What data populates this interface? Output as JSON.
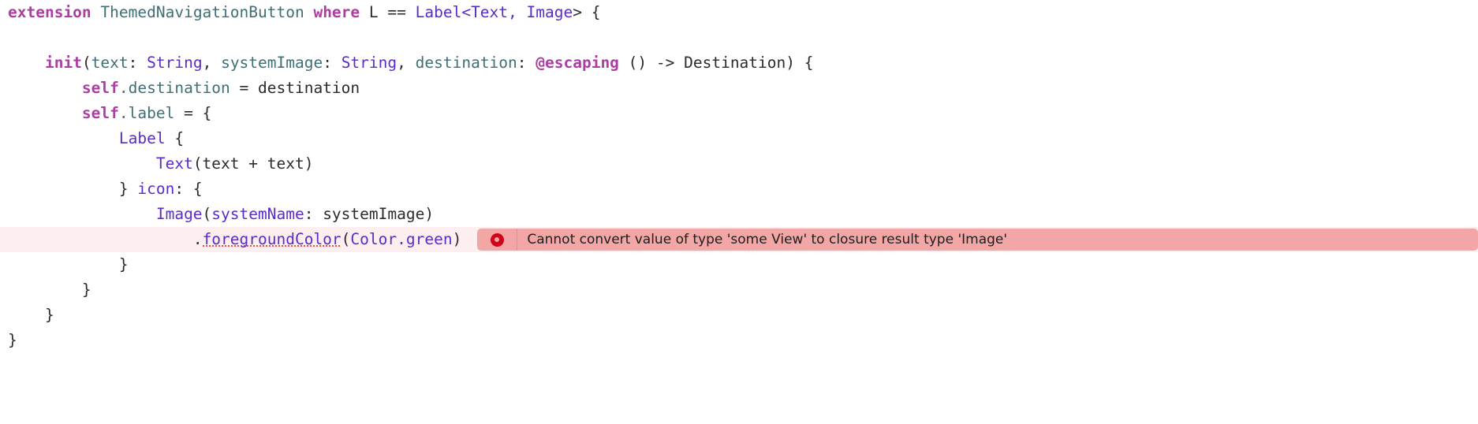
{
  "editor": {
    "language": "Swift",
    "background_color": "#ffffff",
    "font_size_px": 19,
    "line_height_px": 32,
    "colors": {
      "keyword": "#ad3da4",
      "type": "#3f6e74",
      "swiftui_type": "#5b2bc9",
      "plain_text": "#2b2b2b",
      "error_line_background": "#fdeef0",
      "diagnostic_badge_background": "#f3a6a6",
      "diagnostic_icon": "#d0021b",
      "squiggly_underline": "#e5504a"
    }
  },
  "code": {
    "line1": {
      "keyword_extension": "extension",
      "space1": " ",
      "type_name": "ThemedNavigationButton",
      "space2": " ",
      "keyword_where": "where",
      "generic_constraint": " L == ",
      "label_type": "Label",
      "open_angle": "<",
      "text_type": "Text",
      "comma": ", ",
      "image_type": "Image",
      "close": "> {"
    },
    "line2": "",
    "line3": {
      "indent": "    ",
      "keyword_init": "init",
      "paren_open": "(",
      "param_text": "text",
      "colon1": ": ",
      "type_string_1": "String",
      "comma1": ", ",
      "param_systemimage": "systemImage",
      "colon2": ": ",
      "type_string_2": "String",
      "comma2": ", ",
      "param_destination": "destination",
      "colon3": ": ",
      "attr_escaping": "@escaping",
      "closure_sig": " () -> Destination) {"
    },
    "line4": {
      "indent": "        ",
      "keyword_self": "self",
      "dot_member": ".destination",
      "assignment": " = destination"
    },
    "line5": {
      "indent": "        ",
      "keyword_self": "self",
      "dot_member": ".label",
      "assignment": " = {"
    },
    "line6": {
      "indent": "            ",
      "label_type": "Label",
      "brace": " {"
    },
    "line7": {
      "indent": "                ",
      "text_type": "Text",
      "args": "(text + text)"
    },
    "line8": {
      "indent": "            ",
      "close_brace": "} ",
      "icon_label": "icon",
      "colon_brace": ": {"
    },
    "line9": {
      "indent": "                ",
      "image_type": "Image",
      "paren": "(",
      "systemname_label": "systemName",
      "colon": ": ",
      "arg": "systemImage",
      "close_paren": ")"
    },
    "line10": {
      "indent": "                    ",
      "dot": ".",
      "member_error": "foregroundColor",
      "paren_open": "(",
      "color_type": "Color",
      "dot_green": ".",
      "green_member": "green",
      "paren_close": ")"
    },
    "line11": {
      "indent": "            ",
      "brace": "}"
    },
    "line12": {
      "indent": "        ",
      "brace": "}"
    },
    "line13": {
      "indent": "    ",
      "brace": "}"
    },
    "line14": {
      "indent": "",
      "brace": "}"
    }
  },
  "diagnostic": {
    "severity": "error",
    "icon": "error-circle-icon",
    "message": "Cannot convert value of type 'some View' to closure result type 'Image'"
  }
}
